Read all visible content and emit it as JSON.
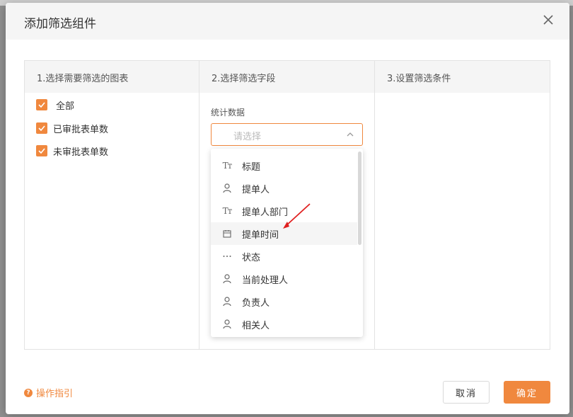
{
  "dialog": {
    "title": "添加筛选组件",
    "columns": {
      "chart_header": "1.选择需要筛选的图表",
      "field_header": "2.选择筛选字段",
      "condition_header": "3.设置筛选条件"
    },
    "charts": [
      {
        "label": "全部",
        "checked": true
      },
      {
        "label": "已审批表单数",
        "checked": true
      },
      {
        "label": "未审批表单数",
        "checked": true
      }
    ],
    "field_section_label": "统计数据",
    "field_select": {
      "placeholder": "请选择"
    },
    "field_options": [
      {
        "label": "标题",
        "icon": "text-icon"
      },
      {
        "label": "提单人",
        "icon": "user-icon"
      },
      {
        "label": "提单人部门",
        "icon": "text-icon"
      },
      {
        "label": "提单时间",
        "icon": "calendar-icon",
        "hovered": true
      },
      {
        "label": "状态",
        "icon": "ellipsis-icon"
      },
      {
        "label": "当前处理人",
        "icon": "user-icon"
      },
      {
        "label": "负责人",
        "icon": "user-icon"
      },
      {
        "label": "相关人",
        "icon": "user-icon"
      }
    ],
    "help_link": "操作指引",
    "cancel_label": "取消",
    "ok_label": "确定"
  },
  "colors": {
    "accent": "#f0883e",
    "annotation_arrow": "#e02020"
  }
}
